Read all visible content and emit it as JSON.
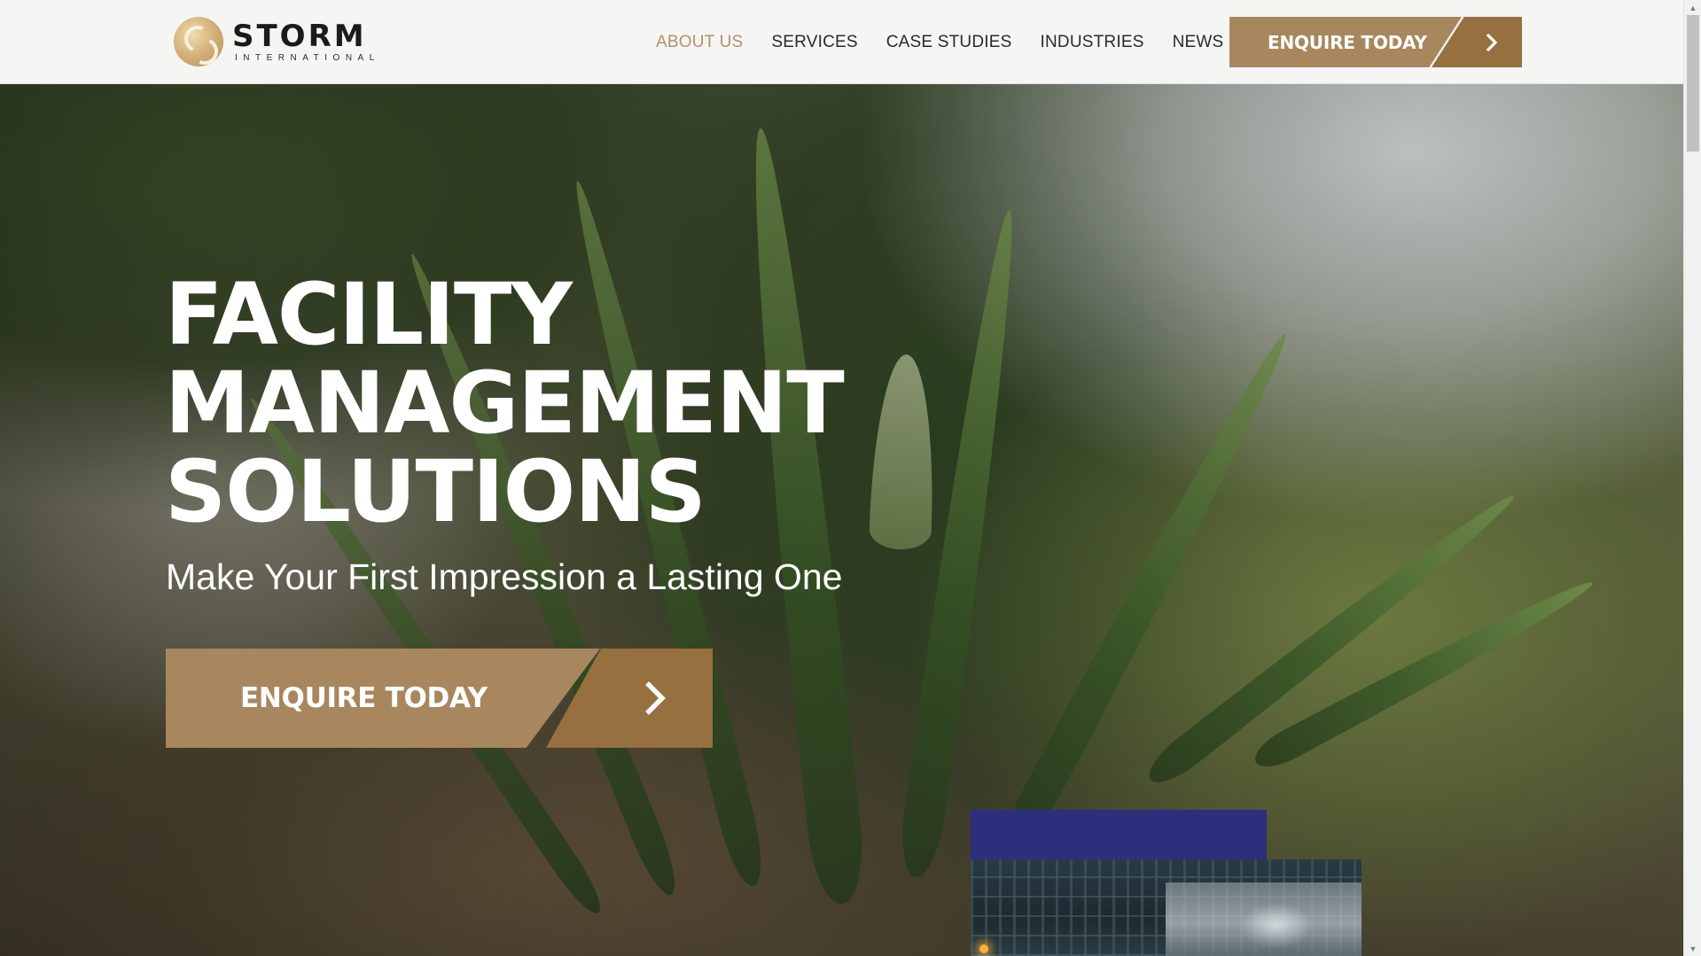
{
  "brand": {
    "name": "STORM",
    "tagline": "INTERNATIONAL"
  },
  "nav": {
    "items": [
      {
        "label": "ABOUT US",
        "active": true
      },
      {
        "label": "SERVICES",
        "active": false
      },
      {
        "label": "CASE STUDIES",
        "active": false
      },
      {
        "label": "INDUSTRIES",
        "active": false
      },
      {
        "label": "NEWS",
        "active": false
      }
    ],
    "cta_label": "ENQUIRE TODAY",
    "cta_icon": "chevron-right-icon"
  },
  "hero": {
    "title_lines": [
      "FACILITY",
      "MANAGEMENT",
      "SOLUTIONS"
    ],
    "subtitle": "Make Your First Impression a Lasting One",
    "cta_label": "ENQUIRE TODAY",
    "cta_icon": "chevron-right-icon"
  },
  "colors": {
    "accent": "#a8875f",
    "accent_dark": "#96703f",
    "active_nav": "#b0926a",
    "card_strip": "#2e2f7c"
  }
}
